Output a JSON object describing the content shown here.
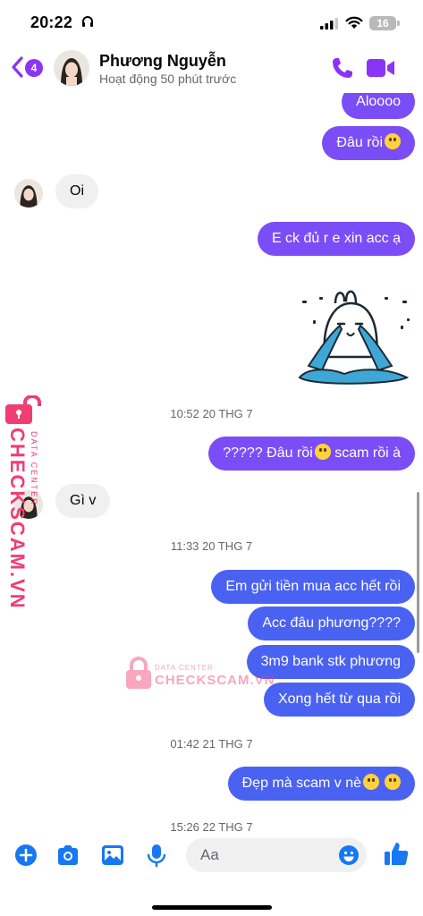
{
  "status_bar": {
    "time": "20:22",
    "battery": "16"
  },
  "header": {
    "back_count": "4",
    "contact_name": "Phương Nguyễn",
    "contact_status": "Hoạt động 50 phút trước"
  },
  "messages": [
    {
      "side": "out",
      "text": "Aloooo"
    },
    {
      "side": "out",
      "text": "Đâu rồi",
      "emoji": "pleading-face"
    },
    {
      "side": "in",
      "text": "Oi"
    },
    {
      "side": "out",
      "text": "E ck đủ r e xin acc ạ"
    },
    {
      "side": "out",
      "sticker": "crying-bunny-sticker"
    },
    {
      "timestamp": "10:52 20 THG 7"
    },
    {
      "side": "out",
      "text_before": "????? Đâu rồi",
      "emoji": "crying-face",
      "text_after": " scam rồi à"
    },
    {
      "side": "in",
      "text": "Gì v"
    },
    {
      "timestamp": "11:33 20 THG 7"
    },
    {
      "side": "out",
      "text": "Em gửi tiền mua acc hết rồi"
    },
    {
      "side": "out",
      "text": "Acc đâu phương????"
    },
    {
      "side": "out",
      "text": "3m9 bank stk phương"
    },
    {
      "side": "out",
      "text": "Xong hết từ qua rồi"
    },
    {
      "timestamp": "01:42 21 THG 7"
    },
    {
      "side": "out",
      "text": "Đẹp mà scam v nè",
      "emoji": "grinning-face x2"
    },
    {
      "timestamp": "15:26 22 THG 7"
    }
  ],
  "watermark": {
    "brand": "CHECKSCAM.VN",
    "sub": "DATA CENTER",
    "mid_brand": "CHECKSCAM.VN",
    "mid_sub": "DATA CENTER"
  },
  "composer": {
    "placeholder": "Aa"
  },
  "colors": {
    "accent": "#8a35f5",
    "bubble_purple": "#7b4df6",
    "bubble_blue": "#4a62f2",
    "incoming_bg": "#f0f0f0",
    "composer_icon": "#1877f2",
    "watermark": "#f03d73"
  }
}
